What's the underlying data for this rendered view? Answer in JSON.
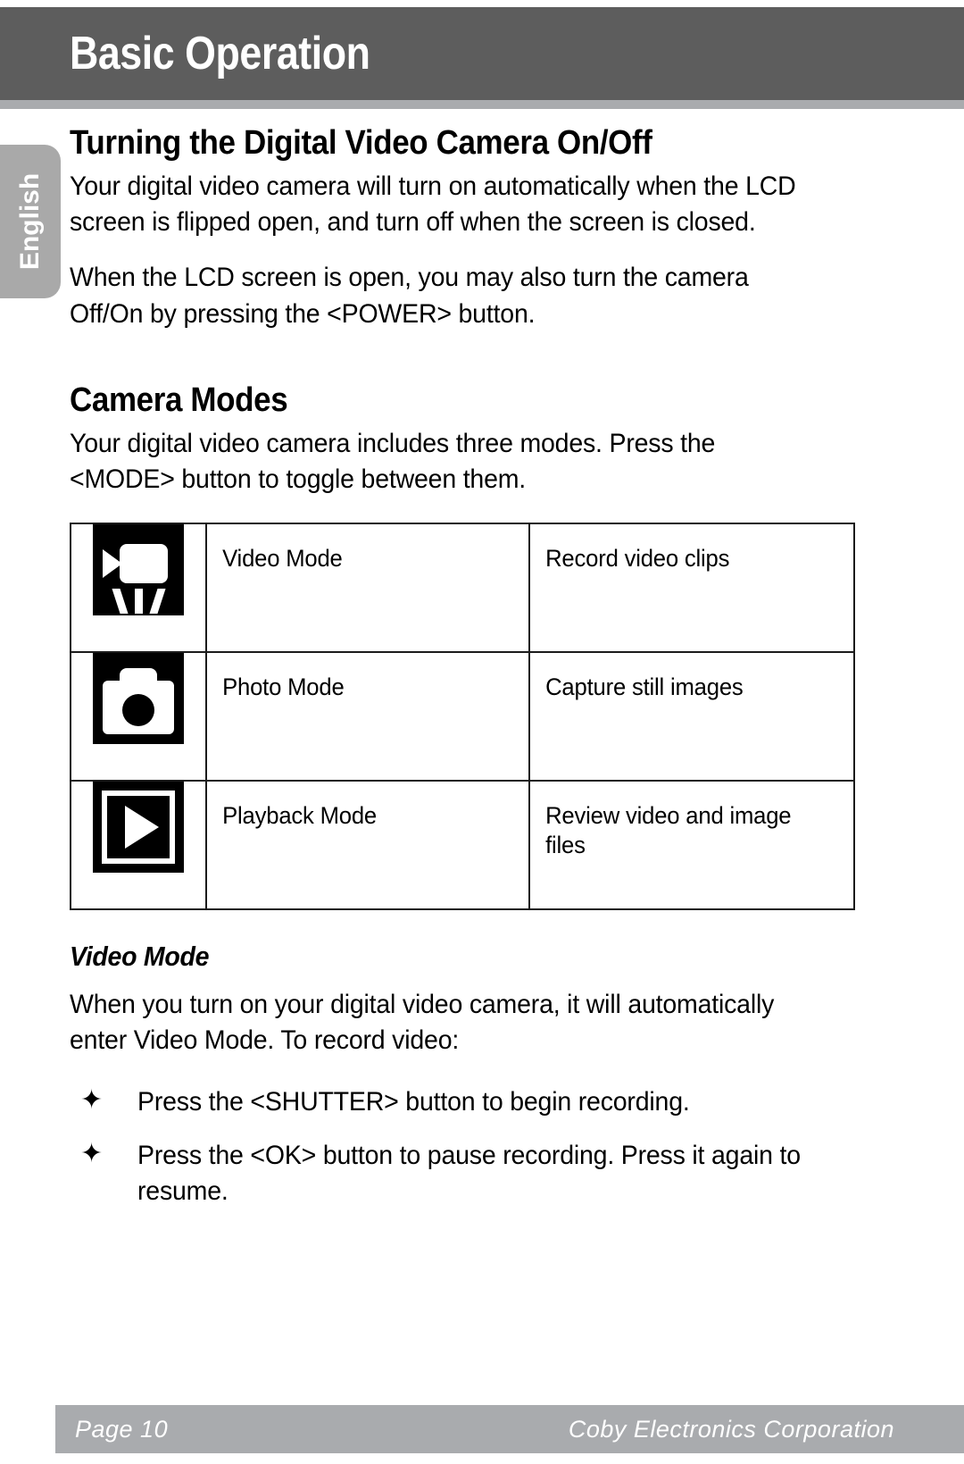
{
  "header": {
    "title": "Basic Operation"
  },
  "language_tab": {
    "label": "English"
  },
  "sections": {
    "power": {
      "heading": "Turning the Digital Video Camera On/Off",
      "paragraph1": "Your digital video camera will turn on automatically when the LCD screen is flipped open, and turn off when the screen is closed.",
      "paragraph2": "When the LCD screen is open, you may also turn the camera Off/On by pressing the <POWER> button."
    },
    "camera_modes": {
      "heading": "Camera Modes",
      "paragraph1": "Your digital video camera includes three modes. Press the <MODE> button to toggle between them."
    },
    "video_mode": {
      "heading": "Video Mode",
      "paragraph1": "When you turn on your digital video camera, it will automatically enter Video Mode.  To record video:",
      "bullets": [
        {
          "glyph": "✦",
          "text": "Press the <SHUTTER> button to begin recording."
        },
        {
          "glyph": "✦",
          "text": "Press the <OK> button to pause recording. Press it again to resume."
        }
      ]
    }
  },
  "modes_table": {
    "rows": [
      {
        "icon": "video-camera-icon",
        "name": "Video Mode",
        "description": "Record video clips"
      },
      {
        "icon": "photo-camera-icon",
        "name": "Photo Mode",
        "description": "Capture still images"
      },
      {
        "icon": "playback-play-icon",
        "name": "Playback Mode",
        "description": "Review video and image files"
      }
    ]
  },
  "footer": {
    "page": "Page 10",
    "company": "Coby Electronics Corporation"
  },
  "colors": {
    "header_bg": "#5d5d5d",
    "accent_gray": "#a9abae",
    "tab_gray": "#a9a9a9",
    "text": "#000000",
    "border": "#1b1b1b"
  }
}
